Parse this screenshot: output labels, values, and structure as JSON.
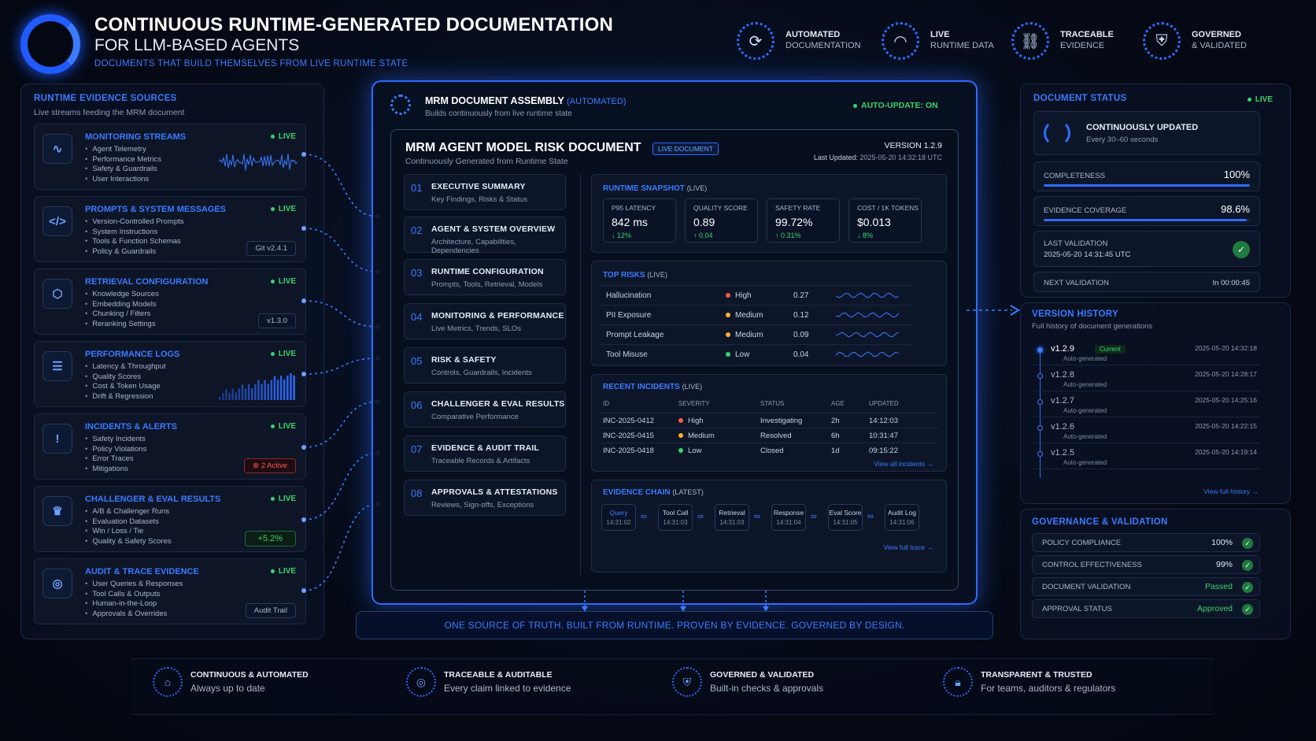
{
  "header": {
    "title": "CONTINUOUS RUNTIME-GENERATED DOCUMENTATION",
    "subtitle": "FOR LLM-BASED AGENTS",
    "tagline": "DOCUMENTS THAT BUILD THEMSELVES FROM LIVE RUNTIME STATE",
    "badges": [
      {
        "title": "AUTOMATED",
        "sub": "DOCUMENTATION",
        "icon": "refresh-icon"
      },
      {
        "title": "LIVE",
        "sub": "RUNTIME DATA",
        "icon": "wifi-icon"
      },
      {
        "title": "TRACEABLE",
        "sub": "EVIDENCE",
        "icon": "link-icon"
      },
      {
        "title": "GOVERNED",
        "sub": "& VALIDATED",
        "icon": "shield-check-icon"
      }
    ]
  },
  "sources": {
    "title": "RUNTIME EVIDENCE SOURCES",
    "subtitle": "Live streams feeding the MRM document",
    "live_label": "LIVE",
    "items": [
      {
        "title": "MONITORING STREAMS",
        "icon": "pulse-icon",
        "bullets": [
          "Agent Telemetry",
          "Performance Metrics",
          "Safety & Guardrails",
          "User Interactions"
        ],
        "tag": ""
      },
      {
        "title": "PROMPTS & SYSTEM MESSAGES",
        "icon": "code-icon",
        "bullets": [
          "Version-Controlled Prompts",
          "System Instructions",
          "Tools & Function Schemas",
          "Policy & Guardrails"
        ],
        "tag": "Git v2.4.1"
      },
      {
        "title": "RETRIEVAL CONFIGURATION",
        "icon": "cube-icon",
        "bullets": [
          "Knowledge Sources",
          "Embedding Models",
          "Chunking / Filters",
          "Reranking Settings"
        ],
        "tag": "v1.3.0"
      },
      {
        "title": "PERFORMANCE LOGS",
        "icon": "database-icon",
        "bullets": [
          "Latency & Throughput",
          "Quality Scores",
          "Cost & Token Usage",
          "Drift & Regression"
        ],
        "tag": ""
      },
      {
        "title": "INCIDENTS & ALERTS",
        "icon": "shield-alert-icon",
        "bullets": [
          "Safety Incidents",
          "Policy Violations",
          "Error Traces",
          "Mitigations"
        ],
        "tag": "⊗ 2 Active"
      },
      {
        "title": "CHALLENGER & EVAL RESULTS",
        "icon": "trophy-icon",
        "bullets": [
          "A/B & Challenger Runs",
          "Evaluation Datasets",
          "Win / Loss / Tie",
          "Quality & Safety Scores"
        ],
        "tag": "+5.2%"
      },
      {
        "title": "AUDIT & TRACE EVIDENCE",
        "icon": "fingerprint-icon",
        "bullets": [
          "User Queries & Responses",
          "Tool Calls & Outputs",
          "Human-in-the-Loop",
          "Approvals & Overrides"
        ],
        "tag": "Audit Trail"
      }
    ]
  },
  "assembly": {
    "title": "MRM DOCUMENT ASSEMBLY",
    "title_tag": "(AUTOMATED)",
    "subtitle": "Builds continuously from live runtime state",
    "auto_update": "AUTO-UPDATE:  ON",
    "doc_title": "MRM AGENT MODEL RISK DOCUMENT",
    "doc_badge": "LIVE DOCUMENT",
    "doc_subtitle": "Continuously Generated from Runtime State",
    "version": "VERSION  1.2.9",
    "last_updated_label": "Last Updated:",
    "last_updated": "2025-05-20 14:32:18 UTC",
    "toc": [
      {
        "num": "01",
        "title": "EXECUTIVE SUMMARY",
        "sub": "Key Findings, Risks & Status"
      },
      {
        "num": "02",
        "title": "AGENT & SYSTEM OVERVIEW",
        "sub": "Architecture, Capabilities, Dependencies"
      },
      {
        "num": "03",
        "title": "RUNTIME CONFIGURATION",
        "sub": "Prompts, Tools, Retrieval, Models"
      },
      {
        "num": "04",
        "title": "MONITORING & PERFORMANCE",
        "sub": "Live Metrics, Trends, SLOs"
      },
      {
        "num": "05",
        "title": "RISK & SAFETY",
        "sub": "Controls, Guardrails, Incidents"
      },
      {
        "num": "06",
        "title": "CHALLENGER & EVAL RESULTS",
        "sub": "Comparative Performance"
      },
      {
        "num": "07",
        "title": "EVIDENCE & AUDIT TRAIL",
        "sub": "Traceable Records & Artifacts"
      },
      {
        "num": "08",
        "title": "APPROVALS & ATTESTATIONS",
        "sub": "Reviews, Sign-offs, Exceptions"
      }
    ],
    "snapshot": {
      "title": "RUNTIME SNAPSHOT",
      "tag": "(LIVE)",
      "metrics": [
        {
          "label": "P95 LATENCY",
          "value": "842 ms",
          "delta": "↓ 12%"
        },
        {
          "label": "QUALITY SCORE",
          "value": "0.89",
          "delta": "↑ 0.04"
        },
        {
          "label": "SAFETY RATE",
          "value": "99.72%",
          "delta": "↑ 0.31%"
        },
        {
          "label": "COST / 1K TOKENS",
          "value": "$0.013",
          "delta": "↓ 8%"
        }
      ]
    },
    "risks": {
      "title": "TOP RISKS",
      "tag": "(LIVE)",
      "rows": [
        {
          "name": "Hallucination",
          "level": "High",
          "color": "#ff5a4a",
          "score": "0.27"
        },
        {
          "name": "PII Exposure",
          "level": "Medium",
          "color": "#ffb02e",
          "score": "0.12"
        },
        {
          "name": "Prompt Leakage",
          "level": "Medium",
          "color": "#ffb02e",
          "score": "0.09"
        },
        {
          "name": "Tool Misuse",
          "level": "Low",
          "color": "#39d36b",
          "score": "0.04"
        }
      ]
    },
    "incidents": {
      "title": "RECENT INCIDENTS",
      "tag": "(LIVE)",
      "headers": [
        "ID",
        "SEVERITY",
        "STATUS",
        "AGE",
        "UPDATED"
      ],
      "rows": [
        {
          "id": "INC-2025-0412",
          "severity": "High",
          "color": "#ff5a4a",
          "status": "Investigating",
          "age": "2h",
          "updated": "14:12:03"
        },
        {
          "id": "INC-2025-0415",
          "severity": "Medium",
          "color": "#ffb02e",
          "status": "Resolved",
          "age": "6h",
          "updated": "10:31:47"
        },
        {
          "id": "INC-2025-0418",
          "severity": "Low",
          "color": "#39d36b",
          "status": "Closed",
          "age": "1d",
          "updated": "09:15:22"
        }
      ],
      "link": "View all incidents →"
    },
    "evidence": {
      "title": "EVIDENCE CHAIN",
      "tag": "(LATEST)",
      "steps": [
        {
          "label": "Query",
          "time": "14:31:02"
        },
        {
          "label": "Tool Call",
          "time": "14:31:03"
        },
        {
          "label": "Retrieval",
          "time": "14:31:03"
        },
        {
          "label": "Response",
          "time": "14:31:04"
        },
        {
          "label": "Eval Score",
          "time": "14:31:05"
        },
        {
          "label": "Audit Log",
          "time": "14:31:06"
        }
      ],
      "link": "View full trace →"
    },
    "banner": "ONE SOURCE OF TRUTH. BUILT FROM RUNTIME. PROVEN BY EVIDENCE. GOVERNED BY DESIGN."
  },
  "status": {
    "title": "DOCUMENT STATUS",
    "live": "LIVE",
    "updated_title": "CONTINUOUSLY UPDATED",
    "updated_sub": "Every 30–60 seconds",
    "completeness_label": "COMPLETENESS",
    "completeness": "100%",
    "completeness_pct": 100,
    "coverage_label": "EVIDENCE COVERAGE",
    "coverage": "98.6%",
    "coverage_pct": 98.6,
    "last_validation_label": "LAST VALIDATION",
    "last_validation": "2025-05-20 14:31:45 UTC",
    "next_validation_label": "NEXT VALIDATION",
    "next_validation": "In 00:00:45"
  },
  "versions": {
    "title": "VERSION HISTORY",
    "subtitle": "Full history of document generations",
    "current_label": "Current",
    "auto_label": "Auto-generated",
    "rows": [
      {
        "v": "v1.2.9",
        "date": "2025-05-20 14:32:18"
      },
      {
        "v": "v1.2.8",
        "date": "2025-05-20 14:28:17"
      },
      {
        "v": "v1.2.7",
        "date": "2025-05-20 14:25:16"
      },
      {
        "v": "v1.2.6",
        "date": "2025-05-20 14:22:15"
      },
      {
        "v": "v1.2.5",
        "date": "2025-05-20 14:19:14"
      }
    ],
    "link": "View full history →"
  },
  "governance": {
    "title": "GOVERNANCE & VALIDATION",
    "rows": [
      {
        "label": "POLICY COMPLIANCE",
        "value": "100%",
        "color": "#dfe7f5"
      },
      {
        "label": "CONTROL EFFECTIVENESS",
        "value": "99%",
        "color": "#dfe7f5"
      },
      {
        "label": "DOCUMENT VALIDATION",
        "value": "Passed",
        "color": "#39d36b"
      },
      {
        "label": "APPROVAL STATUS",
        "value": "Approved",
        "color": "#39d36b"
      }
    ]
  },
  "footer": [
    {
      "title": "CONTINUOUS & AUTOMATED",
      "sub": "Always up to date",
      "icon": "building-icon"
    },
    {
      "title": "TRACEABLE & AUDITABLE",
      "sub": "Every claim linked to evidence",
      "icon": "target-icon"
    },
    {
      "title": "GOVERNED & VALIDATED",
      "sub": "Built-in checks & approvals",
      "icon": "shield-icon"
    },
    {
      "title": "TRANSPARENT & TRUSTED",
      "sub": "For teams, auditors & regulators",
      "icon": "lock-icon"
    }
  ]
}
